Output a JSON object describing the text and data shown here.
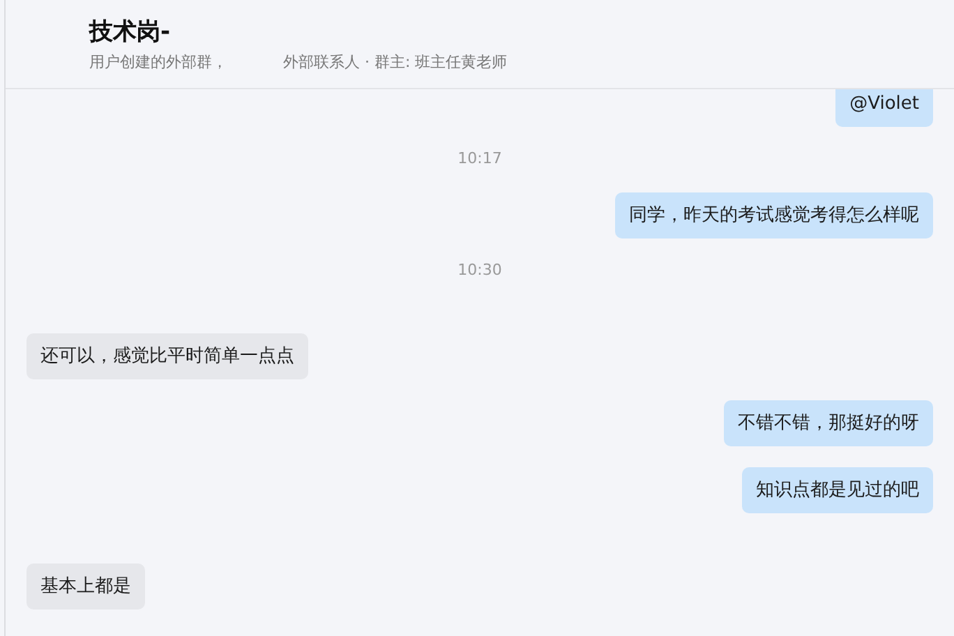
{
  "header": {
    "title": "技术岗-",
    "subtitle_parts": [
      "用户创建的外部群，",
      "外部联系人 · 群主: 班主任黄老师"
    ]
  },
  "messages": [
    {
      "kind": "out",
      "text": "@Violet"
    },
    {
      "kind": "time",
      "text": "10:17"
    },
    {
      "kind": "out",
      "text": "同学，昨天的考试感觉考得怎么样呢"
    },
    {
      "kind": "time",
      "text": "10:30"
    },
    {
      "kind": "in",
      "text": "还可以，感觉比平时简单一点点"
    },
    {
      "kind": "out",
      "text": "不错不错，那挺好的呀"
    },
    {
      "kind": "out",
      "text": "知识点都是见过的吧"
    },
    {
      "kind": "in",
      "text": "基本上都是"
    }
  ]
}
